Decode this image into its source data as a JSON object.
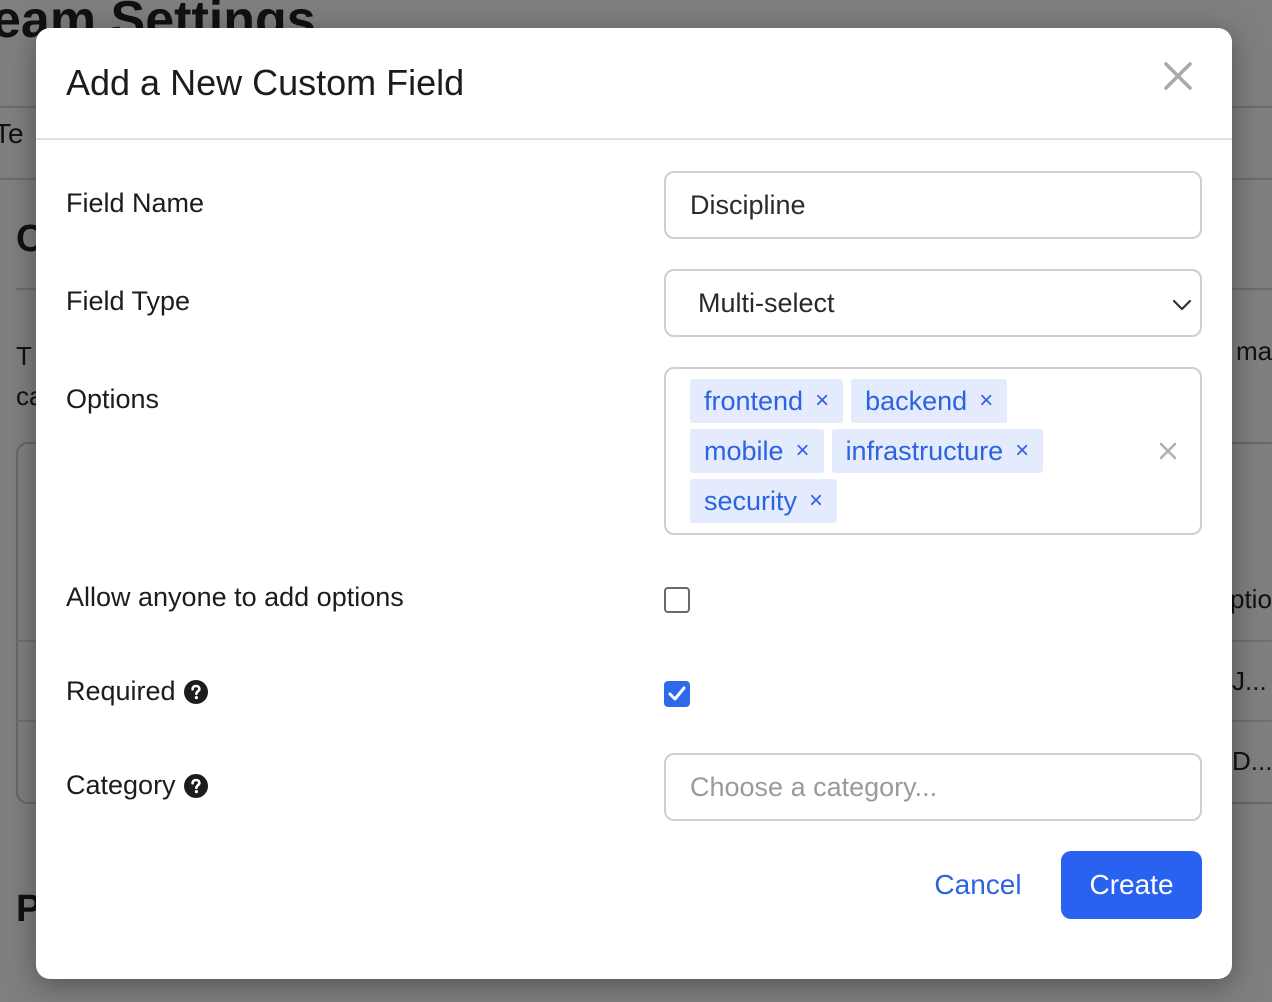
{
  "background": {
    "page_title": "eam Settings",
    "tab_label": "Te",
    "section_heading": "C",
    "description_lines": [
      "T",
      "ca"
    ],
    "description_right": "ma",
    "table_header_right": "ptio",
    "row1_right": "J...",
    "row2_right": "D...",
    "bottom_heading": "P"
  },
  "modal": {
    "title": "Add a New Custom Field",
    "close_icon": "close-icon",
    "fields": {
      "field_name_label": "Field Name",
      "field_name_value": "Discipline",
      "field_type_label": "Field Type",
      "field_type_value": "Multi-select",
      "options_label": "Options",
      "options": [
        "frontend",
        "backend",
        "mobile",
        "infrastructure",
        "security"
      ],
      "tag_remove_glyph": "×",
      "allow_add_label": "Allow anyone to add options",
      "allow_add_checked": false,
      "required_label": "Required",
      "required_checked": true,
      "category_label": "Category",
      "category_placeholder": "Choose a category..."
    },
    "buttons": {
      "cancel": "Cancel",
      "create": "Create"
    }
  },
  "colors": {
    "accent": "#2962f0",
    "tag_bg": "#e3ebfd",
    "tag_text": "#2d63e3",
    "overlay": "rgba(0,0,0,0.5)"
  }
}
